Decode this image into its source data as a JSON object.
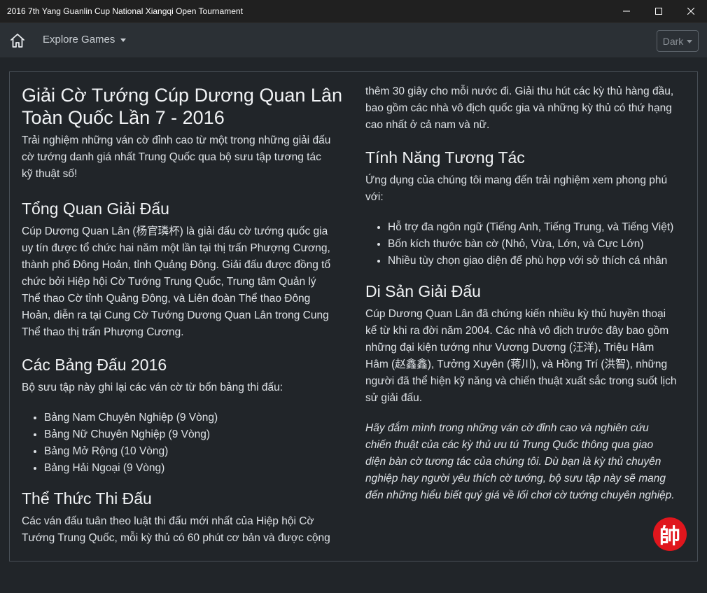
{
  "window": {
    "title": "2016 7th Yang Guanlin Cup National Xiangqi Open Tournament",
    "minimize_icon": "minimize-icon",
    "maximize_icon": "maximize-icon",
    "close_icon": "close-icon"
  },
  "navbar": {
    "home_icon": "home-icon",
    "explore_label": "Explore Games",
    "theme_label": "Dark"
  },
  "content": {
    "title_line1": "Giải Cờ Tướng Cúp Dương Quan Lân",
    "title_line2": "Toàn Quốc Lần 7 - 2016",
    "intro": [
      "Trải nghiệm những ván cờ đỉnh cao từ một trong những giải đấu",
      "cờ tướng danh giá nhất Trung Quốc qua bộ sưu tập tương tác",
      "kỹ thuật số!"
    ],
    "overview_heading": "Tổng Quan Giải Đấu",
    "overview": [
      "Cúp Dương Quan Lân (杨官璘杯) là giải đấu cờ tướng quốc gia",
      "uy tín được tổ chức hai năm một lần tại thị trấn Phượng Cương,",
      "thành phố Đông Hoản, tỉnh Quảng Đông. Giải đấu được đồng tổ",
      "chức bởi Hiệp hội Cờ Tướng Trung Quốc, Trung tâm Quản lý",
      "Thể thao Cờ tỉnh Quảng Đông, và Liên đoàn Thể thao Đông",
      "Hoản, diễn ra tại Cung Cờ Tướng Dương Quan Lân trong Cung",
      "Thể thao thị trấn Phượng Cương."
    ],
    "divisions_heading": "Các Bảng Đấu 2016",
    "divisions_intro": "Bộ sưu tập này ghi lại các ván cờ từ bốn bảng thi đấu:",
    "divisions": [
      "Bảng Nam Chuyên Nghiệp (9 Vòng)",
      "Bảng Nữ Chuyên Nghiệp (9 Vòng)",
      "Bảng Mở Rộng (10 Vòng)",
      "Bảng Hải Ngoại (9 Vòng)"
    ],
    "format_heading": "Thể Thức Thi Đấu",
    "format": [
      "Các ván đấu tuân theo luật thi đấu mới nhất của Hiệp hội Cờ",
      "Tướng Trung Quốc, mỗi kỳ thủ có 60 phút cơ bản và được cộng",
      "thêm 30 giây cho mỗi nước đi. Giải thu hút các kỳ thủ hàng đầu,",
      "bao gồm các nhà vô địch quốc gia và những kỳ thủ có thứ hạng",
      "cao nhất ở cả nam và nữ."
    ],
    "features_heading": "Tính Năng Tương Tác",
    "features_intro": [
      "Ứng dụng của chúng tôi mang đến trải nghiệm xem phong phú",
      "với:"
    ],
    "features": [
      "Hỗ trợ đa ngôn ngữ (Tiếng Anh, Tiếng Trung, và Tiếng Việt)",
      "Bốn kích thước bàn cờ (Nhỏ, Vừa, Lớn, và Cực Lớn)",
      "Nhiều tùy chọn giao diện để phù hợp với sở thích cá nhân"
    ],
    "legacy_heading": "Di Sản Giải Đấu",
    "legacy": [
      "Cúp Dương Quan Lân đã chứng kiến nhiều kỳ thủ huyền thoại",
      "kể từ khi ra đời năm 2004. Các nhà vô địch trước đây bao gồm",
      "những đại kiện tướng như Vương Dương (汪洋), Triệu Hâm",
      "Hâm (赵鑫鑫), Tưởng Xuyên (蒋川), và Hồng Trí (洪智), những",
      "người đã thể hiện kỹ năng và chiến thuật xuất sắc trong suốt lịch",
      "sử giải đấu."
    ],
    "closing": [
      "Hãy đắm mình trong những ván cờ đỉnh cao và nghiên cứu",
      "chiến thuật của các kỳ thủ ưu tú Trung Quốc thông qua giao",
      "diện bàn cờ tương tác của chúng tôi. Dù bạn là kỳ thủ chuyên",
      "nghiệp hay người yêu thích cờ tướng, bộ sưu tập này sẽ mang",
      "đến những hiểu biết quý giá về lối chơi cờ tướng chuyên nghiệp."
    ],
    "seal_char": "帥"
  }
}
